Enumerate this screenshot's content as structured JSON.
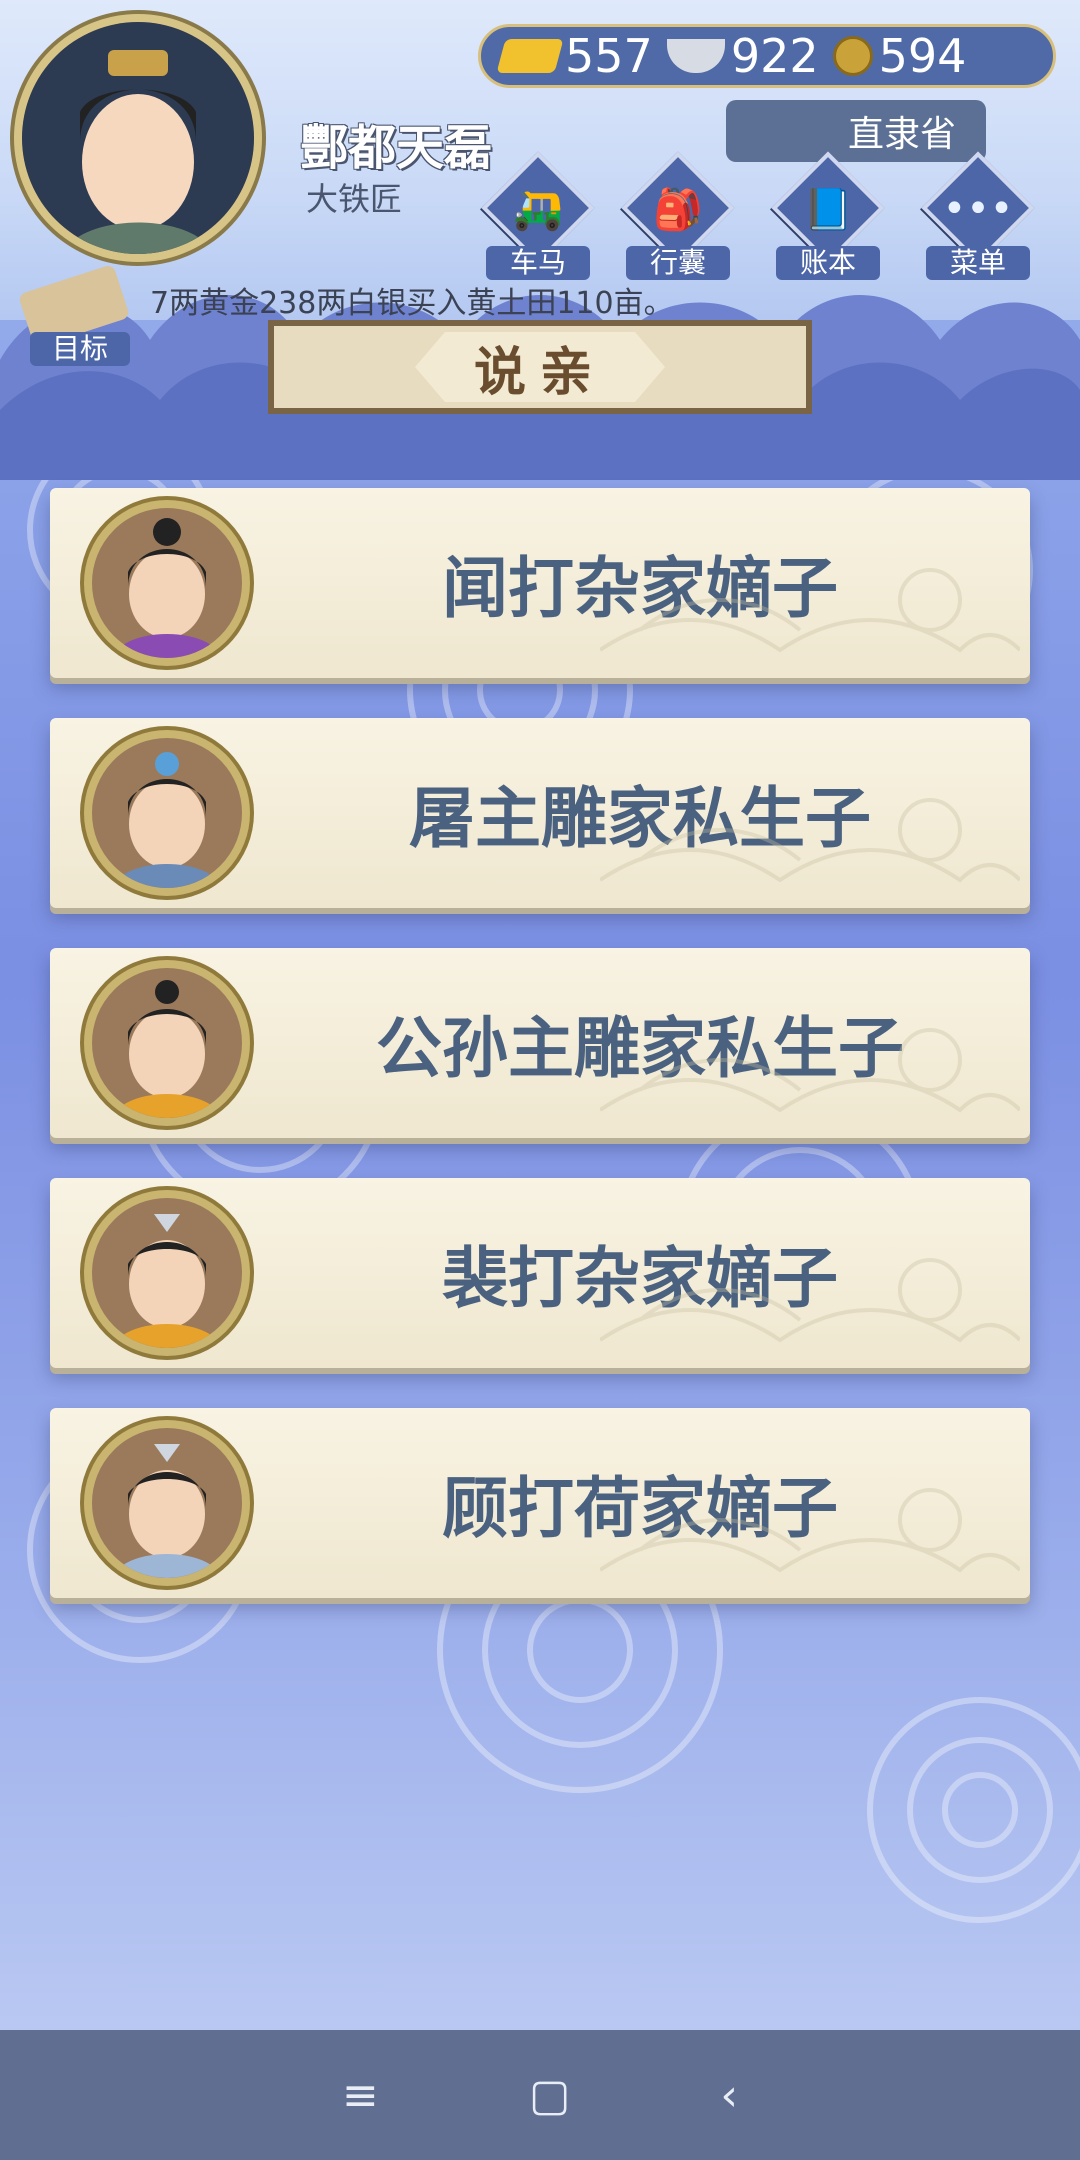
{
  "player": {
    "name": "酆都天磊",
    "title": "大铁匠"
  },
  "currency": {
    "gold": "557",
    "silver": "922",
    "coins": "594"
  },
  "location": "直隶省",
  "nav": [
    {
      "label": "车马",
      "icon": "carriage-icon"
    },
    {
      "label": "行囊",
      "icon": "bag-icon"
    },
    {
      "label": "账本",
      "icon": "ledger-icon"
    },
    {
      "label": "菜单",
      "icon": "menu-dots-icon"
    }
  ],
  "goal": {
    "label": "目标"
  },
  "ticker": "7两黄金238两白银买入黄土田110亩。",
  "title": "说亲",
  "candidates": [
    {
      "name": "闻打杂家嫡子"
    },
    {
      "name": "屠主雕家私生子"
    },
    {
      "name": "公孙主雕家私生子"
    },
    {
      "name": "裴打杂家嫡子"
    },
    {
      "name": "顾打荷家嫡子"
    }
  ],
  "system_nav": {
    "menu": "≡",
    "home": "▢",
    "back": "‹"
  }
}
